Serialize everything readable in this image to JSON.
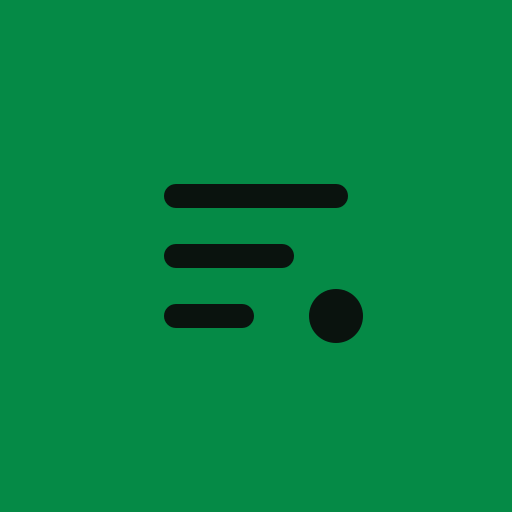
{
  "app_icon": {
    "icon_name": "queue-with-dot-icon",
    "background_color": "#058a46",
    "glyph_color": "#0a130e"
  }
}
